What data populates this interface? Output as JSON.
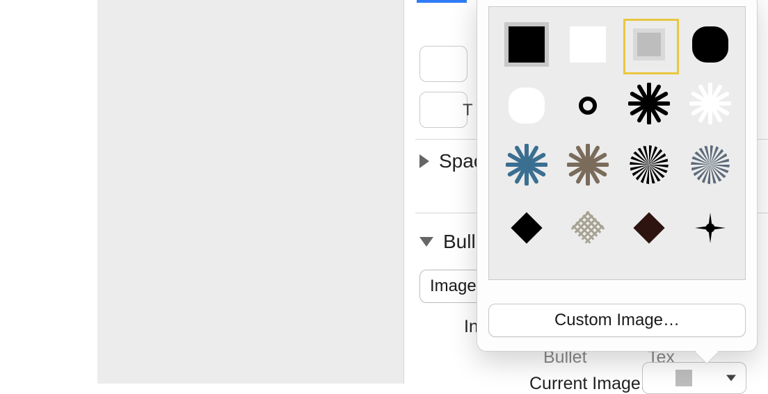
{
  "inspector": {
    "field2_glyph": "T",
    "sections": {
      "spacing_label": "Spac",
      "bullets_label": "Bulle"
    },
    "bullets": {
      "type_dropdown": "Image",
      "indent_label": "In",
      "bullet_column": "Bullet",
      "text_column": "Tex",
      "current_image_label": "Current Image:"
    }
  },
  "popover": {
    "custom_button": "Custom Image…",
    "cells": [
      {
        "id": "black-square"
      },
      {
        "id": "white-square"
      },
      {
        "id": "gray-square",
        "selected": true
      },
      {
        "id": "black-clover"
      },
      {
        "id": "white-clover"
      },
      {
        "id": "ring"
      },
      {
        "id": "starburst-black"
      },
      {
        "id": "starburst-white"
      },
      {
        "id": "starburst-blue"
      },
      {
        "id": "starburst-taupe"
      },
      {
        "id": "pinwheel-black"
      },
      {
        "id": "pinwheel-gray"
      },
      {
        "id": "diamond-black"
      },
      {
        "id": "scribble-diamond"
      },
      {
        "id": "diamond-brown"
      },
      {
        "id": "sparkle"
      },
      {
        "id": "triangle-up"
      }
    ]
  }
}
